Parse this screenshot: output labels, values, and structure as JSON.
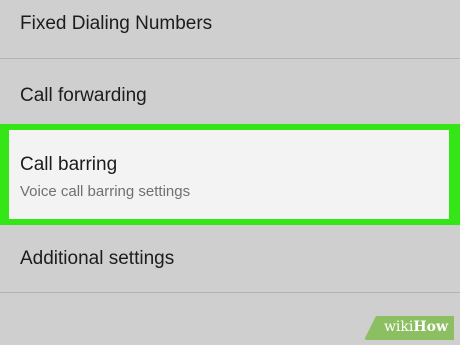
{
  "settings": {
    "items": [
      {
        "label": "Fixed Dialing Numbers"
      },
      {
        "label": "Call forwarding"
      },
      {
        "label": "Call barring",
        "summary": "Voice call barring settings",
        "highlighted": true
      },
      {
        "label": "Additional settings"
      }
    ]
  },
  "watermark": {
    "part1": "wiki",
    "part2": "How"
  },
  "colors": {
    "background": "#cfcfcf",
    "highlight_border": "#34e615",
    "highlight_fill": "#f3f3f3",
    "watermark": "#8cbf62"
  }
}
